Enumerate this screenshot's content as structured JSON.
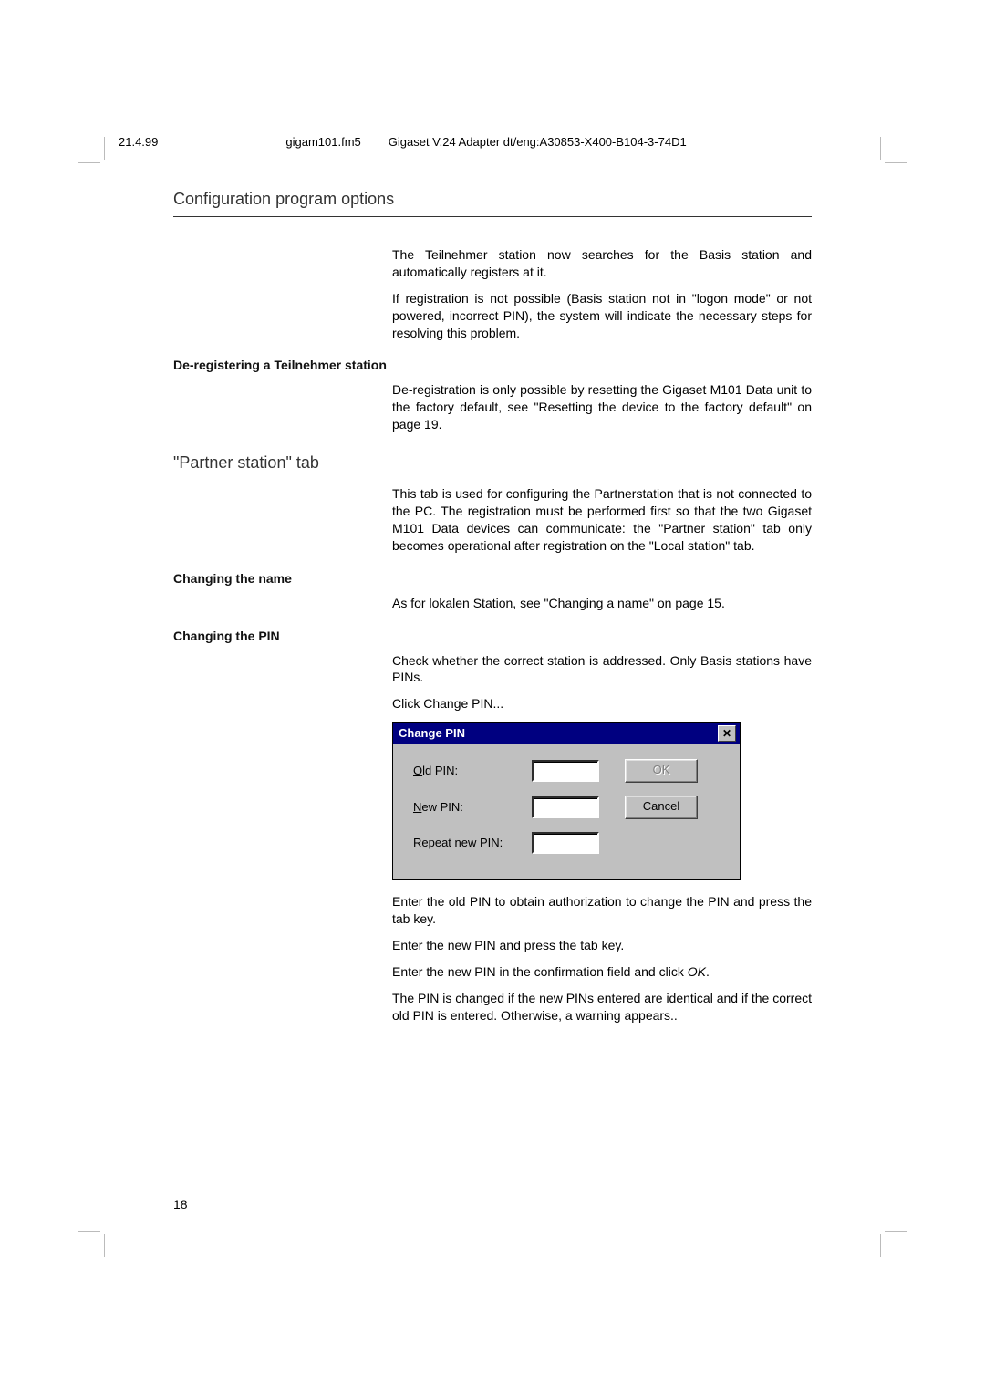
{
  "header": {
    "date": "21.4.99",
    "file": "gigam101.fm5",
    "doc": "Gigaset V.24 Adapter dt/eng:A30853-X400-B104-3-74D1"
  },
  "section_title": "Configuration program options",
  "para1": "The Teilnehmer station now searches for the Basis station and automatically registers at it.",
  "para2": "If registration is not possible (Basis station not in \"logon mode\" or not powered, incorrect PIN), the system will indicate the necessary steps for resolving this problem.",
  "h_dereg": "De-registering a Teilnehmer station",
  "para3": "De-registration is only possible by resetting the Gigaset M101 Data unit to the factory default, see \"Resetting the device to the factory default\" on page 19.",
  "h_partner": "\"Partner station\" tab",
  "para4": "This tab is used for configuring the Partnerstation that is not connected to the PC. The registration must be performed first so that the two Gigaset M101 Data devices can communicate: the \"Partner station\" tab only becomes operational after registration on the \"Local station\" tab.",
  "h_changename": "Changing the name",
  "para5": "As for lokalen Station, see \"Changing a name\" on page 15.",
  "h_changepin": "Changing the PIN",
  "para6": "Check whether the correct station is addressed. Only Basis stations have PINs.",
  "para7": "Click Change PIN...",
  "dialog": {
    "title": "Change PIN",
    "old_label_u": "O",
    "old_label_rest": "ld PIN:",
    "new_label_u": "N",
    "new_label_rest": "ew PIN:",
    "rep_label_u": "R",
    "rep_label_rest": "epeat new PIN:",
    "ok": "OK",
    "cancel": "Cancel"
  },
  "para8": "Enter the old PIN to obtain authorization to change the PIN and press the tab key.",
  "para9": "Enter the new PIN and press the tab key.",
  "para10_a": "Enter the new PIN in the confirmation field and click ",
  "para10_ok": "OK",
  "para10_b": ".",
  "para11": "The PIN is changed if the new PINs entered are identical and if the correct old PIN is entered. Otherwise, a warning appears..",
  "page_number": "18"
}
